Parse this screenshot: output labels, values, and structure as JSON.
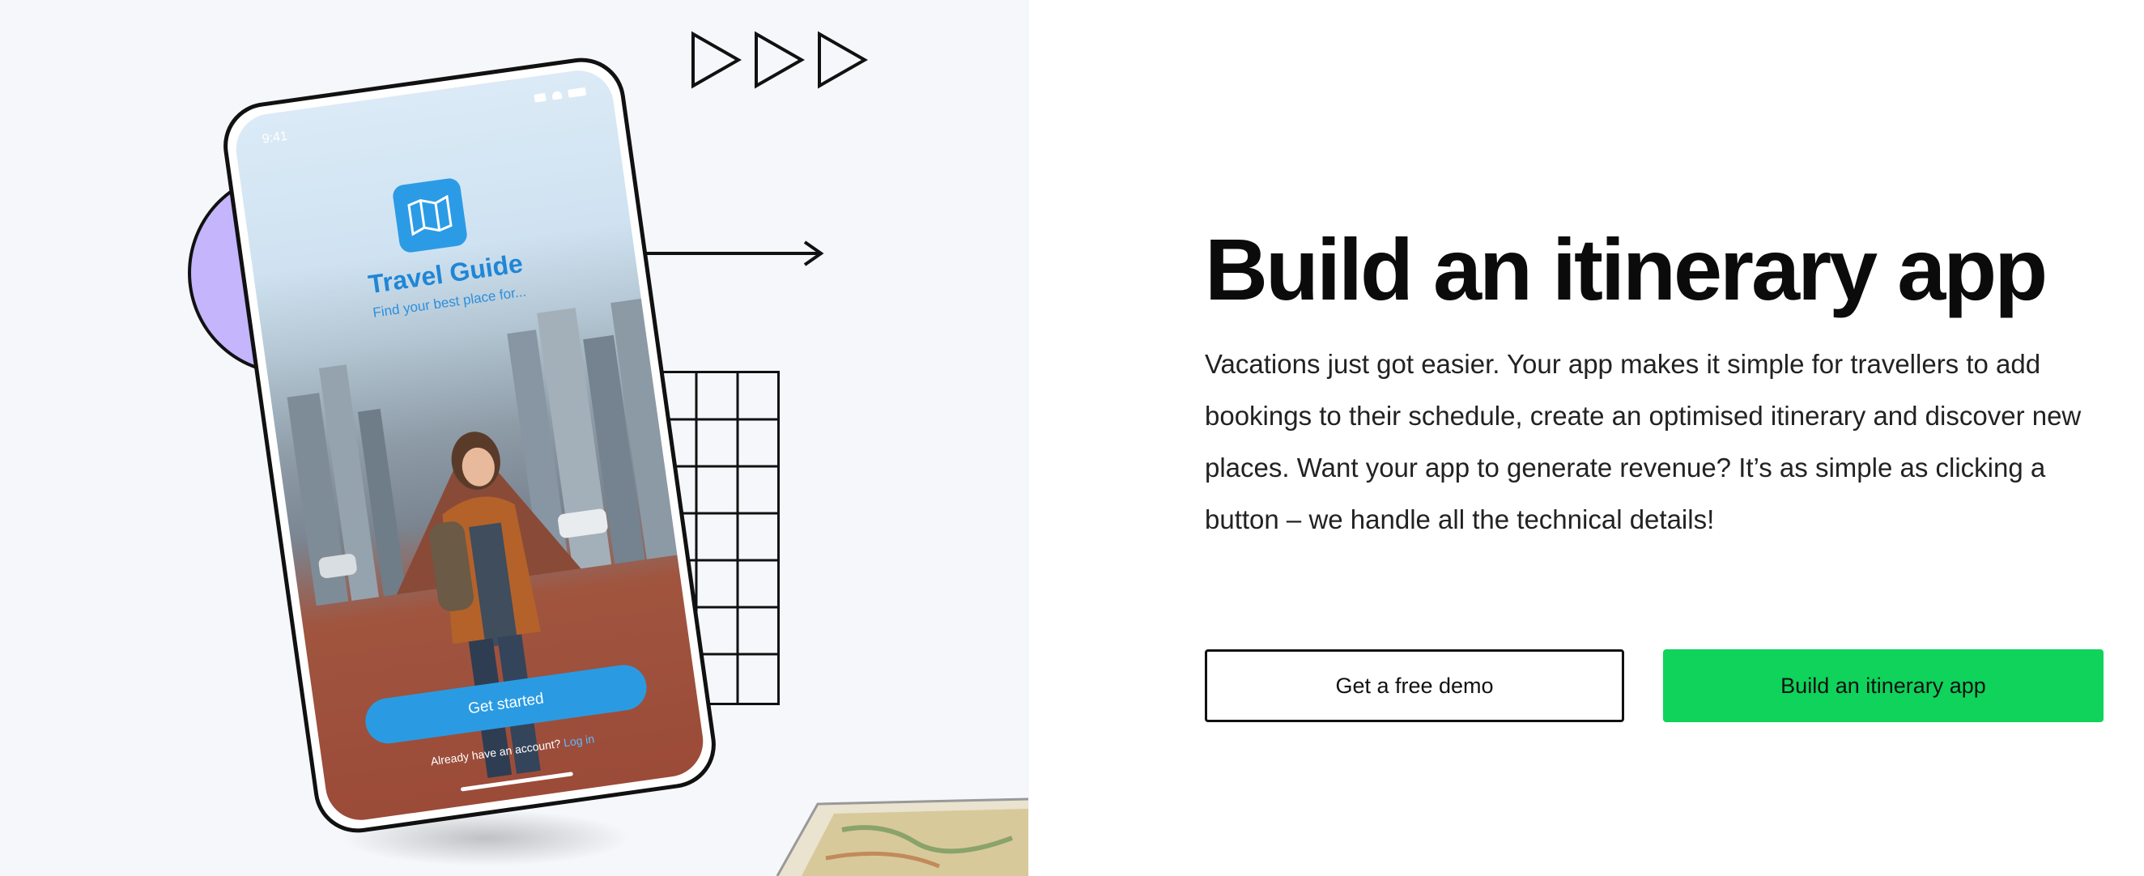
{
  "hero": {
    "headline": "Build an itinerary app",
    "description": "Vacations just got easier. Your app makes it simple for travellers to add bookings to their schedule, create an optimised itinerary and discover new places. Want your app to generate revenue? It’s as simple as clicking a button – we handle all the technical details!",
    "buttons": {
      "demo_label": "Get a free demo",
      "build_label": "Build an itinerary app"
    }
  },
  "phone": {
    "status_time": "9:41",
    "app_title": "Travel Guide",
    "app_subtitle": "Find your best place for...",
    "cta_label": "Get started",
    "account_prompt": "Already have an account?",
    "login_link": "Log in"
  },
  "colors": {
    "accent_green": "#0fd35b",
    "app_blue": "#2a9be2",
    "circle_purple": "#c4b5fd"
  },
  "icons": {
    "play": "play-triangle-icon",
    "arrow": "arrow-right-icon",
    "logo": "map-icon"
  }
}
